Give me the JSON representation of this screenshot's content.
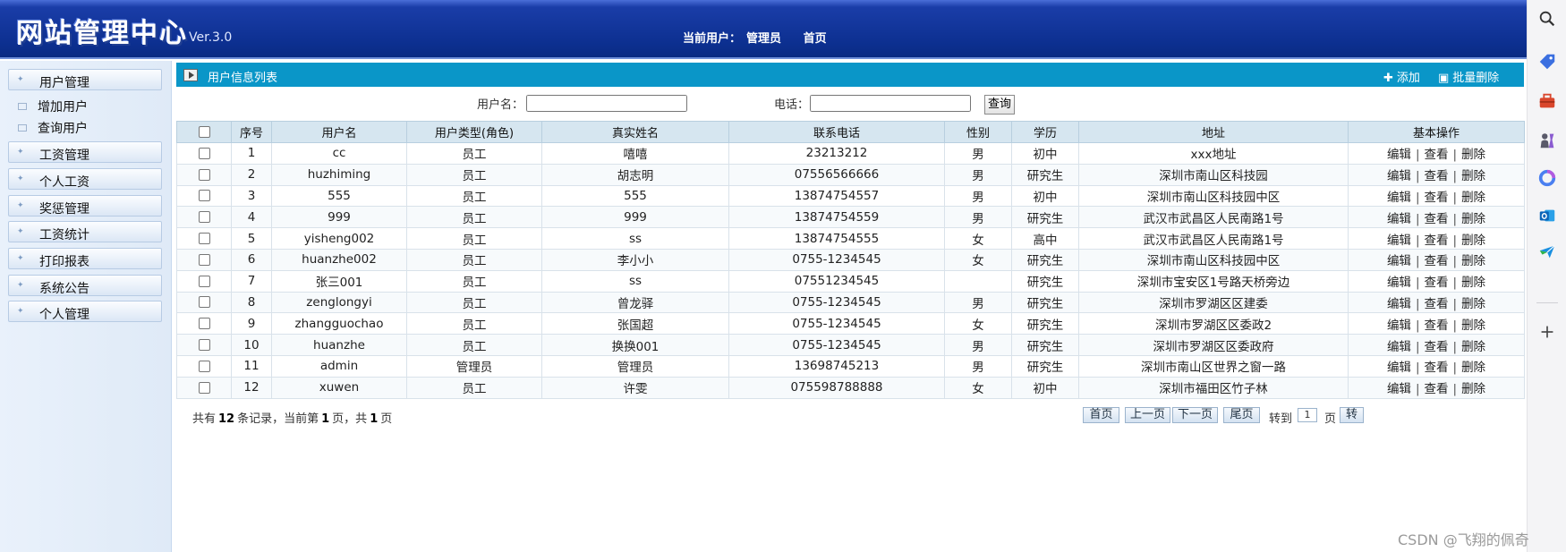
{
  "header": {
    "logo": "网站管理中心",
    "version": "Ver.3.0",
    "current_user_label": "当前用户：",
    "current_user": "管理员",
    "home_link": "首页"
  },
  "sidebar": {
    "groups": [
      {
        "label": "用户管理"
      },
      {
        "label": "工资管理"
      },
      {
        "label": "个人工资"
      },
      {
        "label": "奖惩管理"
      },
      {
        "label": "工资统计"
      },
      {
        "label": "打印报表"
      },
      {
        "label": "系统公告"
      },
      {
        "label": "个人管理"
      }
    ],
    "sub_items": [
      {
        "label": "增加用户"
      },
      {
        "label": "查询用户"
      }
    ]
  },
  "panel": {
    "title": "用户信息列表",
    "add_glyph": "✚",
    "add_label": "添加",
    "batch_delete_glyph": "▣",
    "batch_delete_label": "批量删除"
  },
  "search": {
    "username_label": "用户名：",
    "username_value": "",
    "phone_label": "电话：",
    "phone_value": "",
    "query_button": "查询"
  },
  "table": {
    "columns": [
      "",
      "序号",
      "用户名",
      "用户类型(角色)",
      "真实姓名",
      "联系电话",
      "性别",
      "学历",
      "地址",
      "基本操作"
    ],
    "ops": {
      "edit": "编辑",
      "view": "查看",
      "delete": "删除",
      "sep": "|"
    },
    "rows": [
      {
        "no": "1",
        "username": "cc",
        "role": "员工",
        "realname": "嘻嘻",
        "phone": "23213212",
        "gender": "男",
        "edu": "初中",
        "address": "xxx地址"
      },
      {
        "no": "2",
        "username": "huzhiming",
        "role": "员工",
        "realname": "胡志明",
        "phone": "07556566666",
        "gender": "男",
        "edu": "研究生",
        "address": "深圳市南山区科技园"
      },
      {
        "no": "3",
        "username": "555",
        "role": "员工",
        "realname": "555",
        "phone": "13874754557",
        "gender": "男",
        "edu": "初中",
        "address": "深圳市南山区科技园中区"
      },
      {
        "no": "4",
        "username": "999",
        "role": "员工",
        "realname": "999",
        "phone": "13874754559",
        "gender": "男",
        "edu": "研究生",
        "address": "武汉市武昌区人民南路1号"
      },
      {
        "no": "5",
        "username": "yisheng002",
        "role": "员工",
        "realname": "ss",
        "phone": "13874754555",
        "gender": "女",
        "edu": "高中",
        "address": "武汉市武昌区人民南路1号"
      },
      {
        "no": "6",
        "username": "huanzhe002",
        "role": "员工",
        "realname": "李小小",
        "phone": "0755-1234545",
        "gender": "女",
        "edu": "研究生",
        "address": "深圳市南山区科技园中区"
      },
      {
        "no": "7",
        "username": "张三001",
        "role": "员工",
        "realname": "ss",
        "phone": "07551234545",
        "gender": "",
        "edu": "研究生",
        "address": "深圳市宝安区1号路天桥旁边"
      },
      {
        "no": "8",
        "username": "zenglongyi",
        "role": "员工",
        "realname": "曾龙驿",
        "phone": "0755-1234545",
        "gender": "男",
        "edu": "研究生",
        "address": "深圳市罗湖区区建委"
      },
      {
        "no": "9",
        "username": "zhangguochao",
        "role": "员工",
        "realname": "张国超",
        "phone": "0755-1234545",
        "gender": "女",
        "edu": "研究生",
        "address": "深圳市罗湖区区委政2"
      },
      {
        "no": "10",
        "username": "huanzhe",
        "role": "员工",
        "realname": "换换001",
        "phone": "0755-1234545",
        "gender": "男",
        "edu": "研究生",
        "address": "深圳市罗湖区区委政府"
      },
      {
        "no": "11",
        "username": "admin",
        "role": "管理员",
        "realname": "管理员",
        "phone": "13698745213",
        "gender": "男",
        "edu": "研究生",
        "address": "深圳市南山区世界之窗一路"
      },
      {
        "no": "12",
        "username": "xuwen",
        "role": "员工",
        "realname": "许雯",
        "phone": "075598788888",
        "gender": "女",
        "edu": "初中",
        "address": "深圳市福田区竹子林"
      }
    ]
  },
  "pagination": {
    "summary_prefix": "共有",
    "total": "12",
    "summary_mid": "条记录，当前第",
    "current": "1",
    "summary_mid2": "页，共",
    "pages": "1",
    "summary_suffix": "页",
    "first": "首页",
    "prev": "上一页",
    "next": "下一页",
    "last": "尾页",
    "goto_label": "转到",
    "goto_value": "1",
    "page_unit": "页",
    "go_button": "转"
  },
  "browser_sidebar": {
    "icons": [
      "search-icon",
      "tag-icon",
      "toolbox-icon",
      "chess-icon",
      "copilot-icon",
      "outlook-icon",
      "send-icon",
      "plus-icon"
    ]
  },
  "watermark": "CSDN @飞翔的佩奇"
}
